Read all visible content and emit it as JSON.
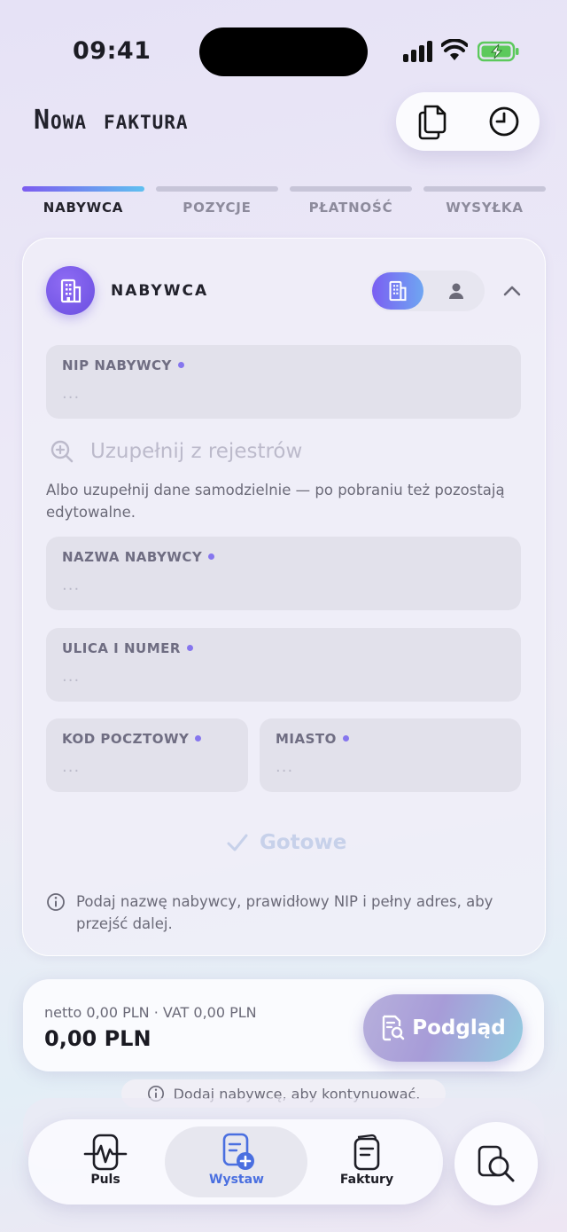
{
  "status_bar": {
    "time": "09:41"
  },
  "header": {
    "title": "Nowa faktura",
    "actions": [
      {
        "icon": "documents-icon"
      },
      {
        "icon": "clock-icon"
      }
    ]
  },
  "steps": [
    {
      "label": "NABYWCA",
      "active": true
    },
    {
      "label": "POZYCJE",
      "active": false
    },
    {
      "label": "PŁATNOŚĆ",
      "active": false
    },
    {
      "label": "WYSYŁKA",
      "active": false
    }
  ],
  "buyer_section": {
    "title": "NABYWCA",
    "type_toggle": {
      "options": [
        "building-icon",
        "person-icon"
      ],
      "selected": "building-icon"
    },
    "nip_field": {
      "label": "NIP NABYWCY",
      "placeholder": "..."
    },
    "lookup_label": "Uzupełnij z rejestrów",
    "hint": "Albo uzupełnij dane samodzielnie — po pobraniu też pozostają edytowalne.",
    "name_field": {
      "label": "NAZWA NABYWCY",
      "placeholder": "..."
    },
    "street_field": {
      "label": "ULICA I NUMER",
      "placeholder": "..."
    },
    "postal_field": {
      "label": "KOD POCZTOWY",
      "placeholder": "..."
    },
    "city_field": {
      "label": "MIASTO",
      "placeholder": "..."
    },
    "done_label": "Gotowe",
    "info": "Podaj nazwę nabywcy, prawidłowy NIP i pełny adres, aby przejść dalej."
  },
  "summary": {
    "net_vat": "netto 0,00 PLN · VAT 0,00 PLN",
    "total": "0,00 PLN",
    "preview_label": "Podgląd"
  },
  "toast": "Dodaj nabywcę, aby kontynuować.",
  "nav": [
    {
      "label": "Puls",
      "icon": "pulse-icon",
      "active": false
    },
    {
      "label": "Wystaw",
      "icon": "new-invoice-icon",
      "active": true
    },
    {
      "label": "Faktury",
      "icon": "invoices-icon",
      "active": false
    }
  ],
  "colors": {
    "accent": "#7a5ff2",
    "accent2": "#5fc0f0",
    "nav_active": "#4a6fe0"
  }
}
